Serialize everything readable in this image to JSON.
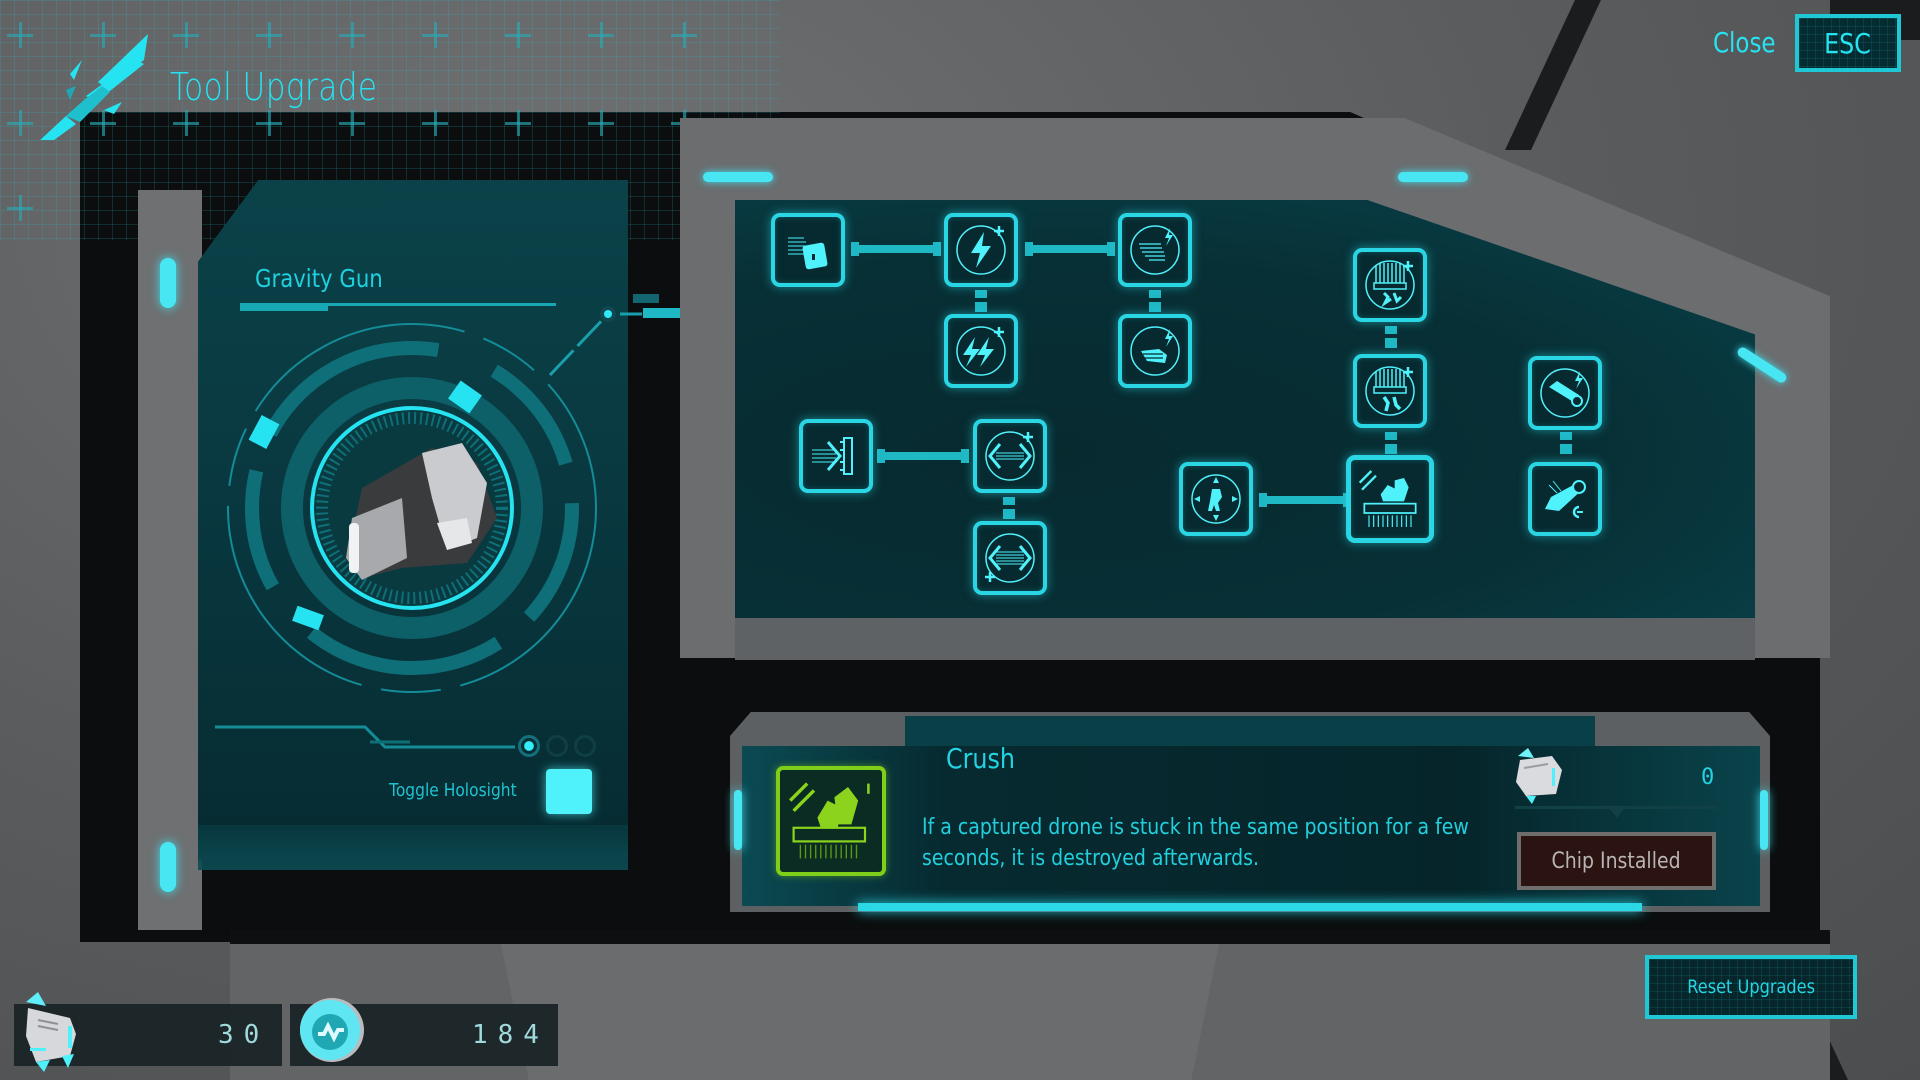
{
  "header": {
    "title": "Tool Upgrade",
    "close_label": "Close",
    "close_key": "ESC"
  },
  "tool": {
    "name": "Gravity Gun",
    "holosight_label": "Toggle Holosight",
    "holosight_on": true,
    "pages": {
      "total": 3,
      "current": 1
    }
  },
  "upgrade_tree": {
    "nodes": [
      {
        "id": "n1",
        "icon": "key-upgrade-icon",
        "state": "unlocked"
      },
      {
        "id": "n2",
        "icon": "lightning-plus-icon",
        "state": "unlocked"
      },
      {
        "id": "n3",
        "icon": "shield-lightning-icon",
        "state": "unlocked"
      },
      {
        "id": "n4",
        "icon": "double-lightning-plus-icon",
        "state": "unlocked"
      },
      {
        "id": "n5",
        "icon": "shield-lightning-2-icon",
        "state": "unlocked"
      },
      {
        "id": "n6",
        "icon": "pull-arrow-icon",
        "state": "unlocked"
      },
      {
        "id": "n7",
        "icon": "range-plus-icon",
        "state": "unlocked"
      },
      {
        "id": "n8",
        "icon": "range-plus-2-icon",
        "state": "unlocked"
      },
      {
        "id": "n9",
        "icon": "crusher-plus-icon",
        "state": "unlocked"
      },
      {
        "id": "n10",
        "icon": "crusher-plus-2-icon",
        "state": "unlocked"
      },
      {
        "id": "n11",
        "icon": "target-drone-icon",
        "state": "unlocked"
      },
      {
        "id": "n12",
        "icon": "crush-icon",
        "state": "selected"
      },
      {
        "id": "n13",
        "icon": "launcher-lightning-icon",
        "state": "unlocked"
      },
      {
        "id": "n14",
        "icon": "launcher-icon",
        "state": "unlocked"
      }
    ]
  },
  "detail": {
    "title": "Crush",
    "description": "If a captured drone is stuck in the same position for a few seconds, it is destroyed afterwards.",
    "cost": "0",
    "button_label": "Chip Installed",
    "accent": "#7fcf1a"
  },
  "currencies": [
    {
      "name": "chips",
      "value": "30"
    },
    {
      "name": "credits",
      "value": "184"
    }
  ],
  "reset_label": "Reset Upgrades",
  "colors": {
    "accent": "#26e3f2",
    "panel": "#062a30",
    "selected": "#7fcf1a"
  }
}
